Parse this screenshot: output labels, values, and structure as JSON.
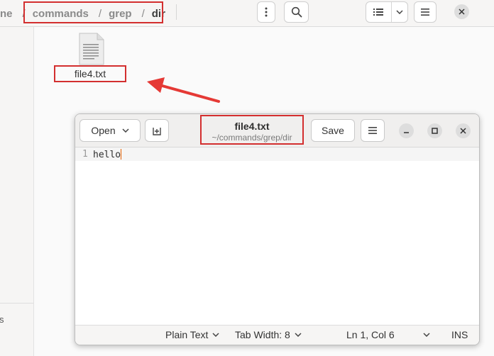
{
  "file_manager": {
    "breadcrumb": {
      "partial_home": "ne",
      "parts": [
        "commands",
        "grep"
      ],
      "current": "dir",
      "separator": "/"
    },
    "file": {
      "name": "file4.txt"
    },
    "sidebar_fragment": "s",
    "icons": {
      "more": "vertical-dots-icon",
      "search": "search-icon",
      "view": "list-view-icon",
      "view_dropdown": "chevron-down-icon",
      "menu": "hamburger-menu-icon",
      "close": "close-icon"
    }
  },
  "editor": {
    "open_label": "Open",
    "title": "file4.txt",
    "subtitle": "~/commands/grep/dir",
    "save_label": "Save",
    "lines": [
      {
        "number": "1",
        "text": "hello"
      }
    ],
    "status": {
      "language": "Plain Text",
      "tab_width": "Tab Width: 8",
      "position": "Ln 1, Col 6",
      "mode": "INS"
    }
  },
  "colors": {
    "annotation": "#d32f2f",
    "caret": "#e66000"
  }
}
